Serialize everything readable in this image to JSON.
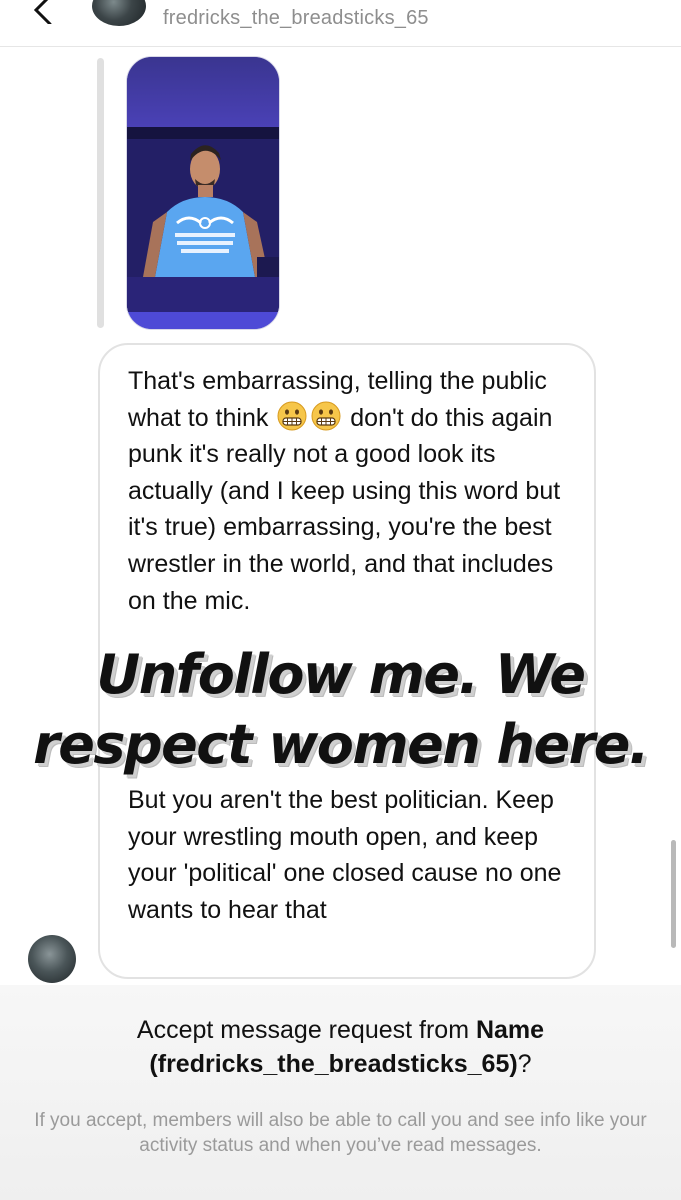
{
  "header": {
    "username": "fredricks_the_breadsticks_65"
  },
  "message": {
    "part1_a": "That's embarrassing, telling the public what to think",
    "part1_b": "don't do this again punk it's really not a good look its actually (and I keep using this word but it's true) embarrassing, you're the best wrestler in the world, and that includes on the mic.",
    "part2": "But you aren't the best politician. Keep your wrestling mouth open, and keep your 'political' one closed cause no one wants to hear that",
    "emoji": "grimacing-face"
  },
  "overlay": {
    "line1": "Unfollow me. We",
    "line2": "respect women here."
  },
  "accept": {
    "prefix": "Accept message request from",
    "name": "Name",
    "handle": "(fredricks_the_breadsticks_65)",
    "suffix": "?",
    "info": "If you accept, members will also be able to call you and see info like your activity status and when you’ve read messages."
  },
  "icons": {
    "back": "chevron-left-icon"
  },
  "colors": {
    "media_purple": "#4b3fb0",
    "text_secondary": "#8e8e8e"
  }
}
